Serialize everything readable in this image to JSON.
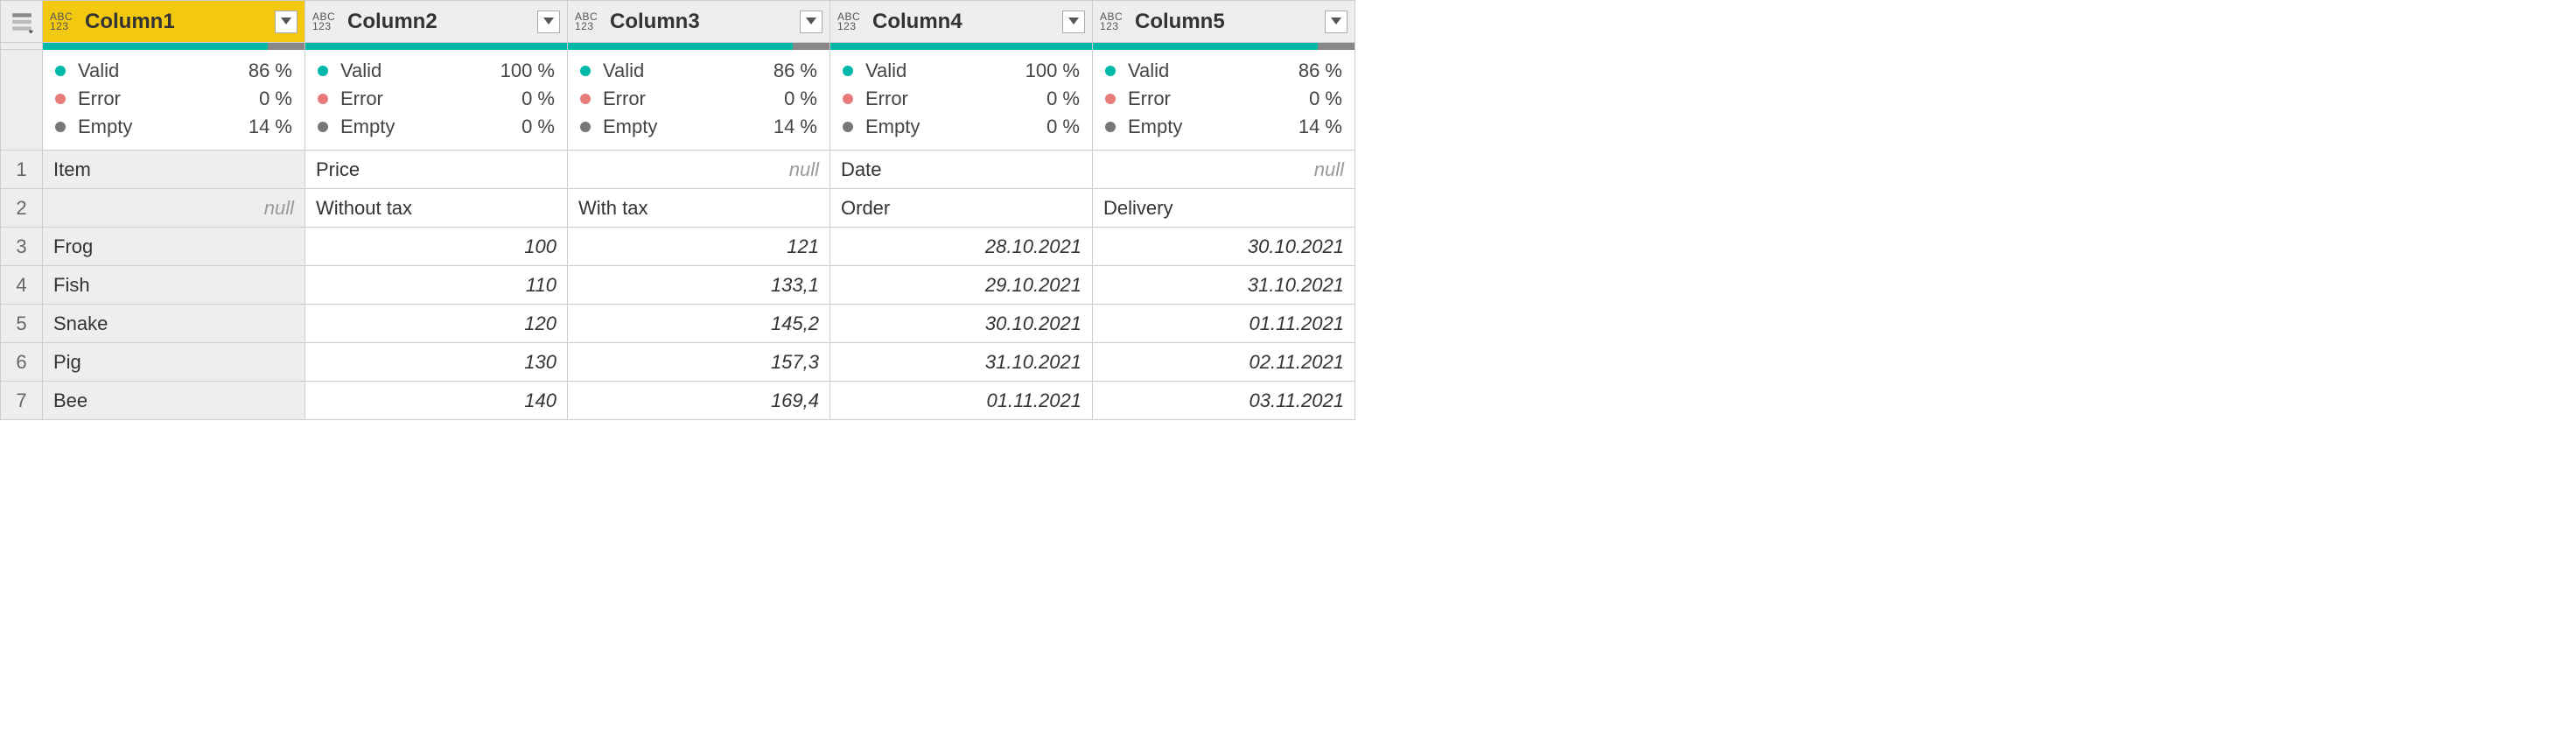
{
  "typeIcon": {
    "top": "ABC",
    "bottom": "123"
  },
  "quality_labels": {
    "valid": "Valid",
    "error": "Error",
    "empty": "Empty"
  },
  "columns": [
    {
      "name": "Column1",
      "selected": true,
      "quality": {
        "valid": "86 %",
        "error": "0 %",
        "empty": "14 %"
      },
      "bar": {
        "valid": 86,
        "error": 0,
        "empty": 14
      }
    },
    {
      "name": "Column2",
      "selected": false,
      "quality": {
        "valid": "100 %",
        "error": "0 %",
        "empty": "0 %"
      },
      "bar": {
        "valid": 100,
        "error": 0,
        "empty": 0
      }
    },
    {
      "name": "Column3",
      "selected": false,
      "quality": {
        "valid": "86 %",
        "error": "0 %",
        "empty": "14 %"
      },
      "bar": {
        "valid": 86,
        "error": 0,
        "empty": 14
      }
    },
    {
      "name": "Column4",
      "selected": false,
      "quality": {
        "valid": "100 %",
        "error": "0 %",
        "empty": "0 %"
      },
      "bar": {
        "valid": 100,
        "error": 0,
        "empty": 0
      }
    },
    {
      "name": "Column5",
      "selected": false,
      "quality": {
        "valid": "86 %",
        "error": "0 %",
        "empty": "14 %"
      },
      "bar": {
        "valid": 86,
        "error": 0,
        "empty": 14
      }
    }
  ],
  "rows": [
    {
      "num": "1",
      "cells": [
        {
          "text": "Item",
          "align": "left",
          "style": "normal"
        },
        {
          "text": "Price",
          "align": "left",
          "style": "normal"
        },
        {
          "text": "null",
          "align": "right",
          "style": "null"
        },
        {
          "text": "Date",
          "align": "left",
          "style": "normal"
        },
        {
          "text": "null",
          "align": "right",
          "style": "null"
        }
      ]
    },
    {
      "num": "2",
      "cells": [
        {
          "text": "null",
          "align": "right",
          "style": "null"
        },
        {
          "text": "Without tax",
          "align": "left",
          "style": "normal"
        },
        {
          "text": "With tax",
          "align": "left",
          "style": "normal"
        },
        {
          "text": "Order",
          "align": "left",
          "style": "normal"
        },
        {
          "text": "Delivery",
          "align": "left",
          "style": "normal"
        }
      ]
    },
    {
      "num": "3",
      "cells": [
        {
          "text": "Frog",
          "align": "left",
          "style": "normal"
        },
        {
          "text": "100",
          "align": "right",
          "style": "italic"
        },
        {
          "text": "121",
          "align": "right",
          "style": "italic"
        },
        {
          "text": "28.10.2021",
          "align": "right",
          "style": "italic"
        },
        {
          "text": "30.10.2021",
          "align": "right",
          "style": "italic"
        }
      ]
    },
    {
      "num": "4",
      "cells": [
        {
          "text": "Fish",
          "align": "left",
          "style": "normal"
        },
        {
          "text": "110",
          "align": "right",
          "style": "italic"
        },
        {
          "text": "133,1",
          "align": "right",
          "style": "italic"
        },
        {
          "text": "29.10.2021",
          "align": "right",
          "style": "italic"
        },
        {
          "text": "31.10.2021",
          "align": "right",
          "style": "italic"
        }
      ]
    },
    {
      "num": "5",
      "cells": [
        {
          "text": "Snake",
          "align": "left",
          "style": "normal"
        },
        {
          "text": "120",
          "align": "right",
          "style": "italic"
        },
        {
          "text": "145,2",
          "align": "right",
          "style": "italic"
        },
        {
          "text": "30.10.2021",
          "align": "right",
          "style": "italic"
        },
        {
          "text": "01.11.2021",
          "align": "right",
          "style": "italic"
        }
      ]
    },
    {
      "num": "6",
      "cells": [
        {
          "text": "Pig",
          "align": "left",
          "style": "normal"
        },
        {
          "text": "130",
          "align": "right",
          "style": "italic"
        },
        {
          "text": "157,3",
          "align": "right",
          "style": "italic"
        },
        {
          "text": "31.10.2021",
          "align": "right",
          "style": "italic"
        },
        {
          "text": "02.11.2021",
          "align": "right",
          "style": "italic"
        }
      ]
    },
    {
      "num": "7",
      "cells": [
        {
          "text": "Bee",
          "align": "left",
          "style": "normal"
        },
        {
          "text": "140",
          "align": "right",
          "style": "italic"
        },
        {
          "text": "169,4",
          "align": "right",
          "style": "italic"
        },
        {
          "text": "01.11.2021",
          "align": "right",
          "style": "italic"
        },
        {
          "text": "03.11.2021",
          "align": "right",
          "style": "italic"
        }
      ]
    }
  ]
}
